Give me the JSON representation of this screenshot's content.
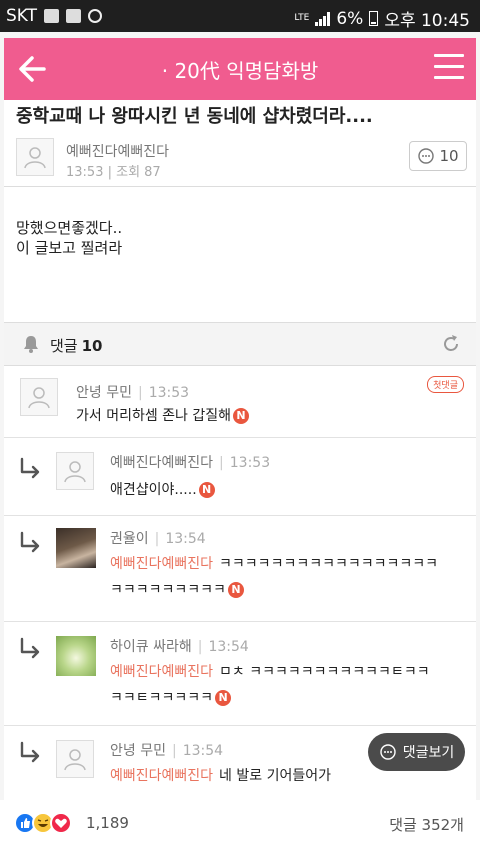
{
  "status_bar": {
    "carrier": "SKT",
    "network": "LTE",
    "battery": "6%",
    "time": "오후 10:45"
  },
  "header": {
    "title": "· 20代 익명담화방"
  },
  "post": {
    "title": "중학교때 나 왕따시킨 년 동네에 샵차렸더라....",
    "author": "예뻐진다예뻐진다",
    "meta": "13:53 | 조회 87",
    "comment_count": "10",
    "body_lines": [
      "망했으면좋겠다..",
      "이 글보고 찔려라"
    ]
  },
  "comments_header": {
    "label": "댓글",
    "count": "10"
  },
  "comments": [
    {
      "name": "안녕 무민",
      "time": "13:53",
      "badge": "첫댓글",
      "text": "가서 머리하셈 존나 갑질해",
      "new": "N"
    },
    {
      "name": "예뻐진다예뻐진다",
      "time": "13:53",
      "text": "애견샵이야.....",
      "new": "N"
    },
    {
      "name": "권율이",
      "time": "13:54",
      "mention": "예뻐진다예뻐진다",
      "text1": "ㅋㅋㅋㅋㅋㅋㅋㅋㅋㅋㅋㅋㅋㅋㅋㅋㅋ",
      "text2": "ㅋㅋㅋㅋㅋㅋㅋㅋㅋ",
      "new": "N"
    },
    {
      "name": "하이큐 싸라해",
      "time": "13:54",
      "mention": "예뻐진다예뻐진다",
      "text1": "ㅁㅊ ㅋㅋㅋㅋㅋㅋㅋㅋㅋㅋㅋㅌㅋㅋ",
      "text2": "ㅋㅋㅌㅋㅋㅋㅋㅋ",
      "new": "N"
    },
    {
      "name": "안녕 무민",
      "time": "13:54",
      "mention": "예뻐진다예뻐진다",
      "text": "네 발로 기어들어가"
    }
  ],
  "floating_button": {
    "label": "댓글보기"
  },
  "footer": {
    "reactions_count": "1,189",
    "comments_count": "댓글 352개"
  },
  "colors": {
    "header": "#f05c8f",
    "mention": "#e9745f",
    "new_badge": "#e9573f"
  }
}
